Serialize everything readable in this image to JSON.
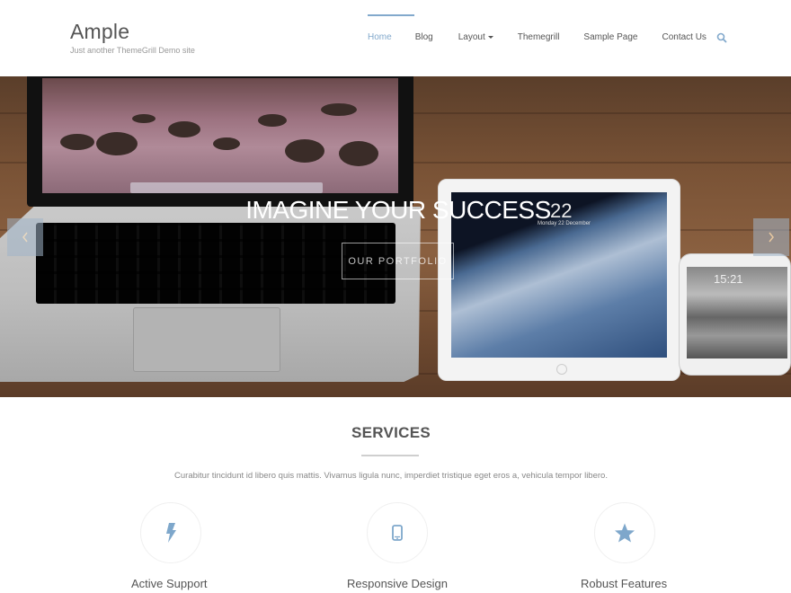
{
  "header": {
    "site_title": "Ample",
    "tagline": "Just another ThemeGrill Demo site",
    "nav": [
      {
        "label": "Home",
        "active": true
      },
      {
        "label": "Blog",
        "active": false
      },
      {
        "label": "Layout",
        "active": false,
        "has_dropdown": true
      },
      {
        "label": "Themegrill",
        "active": false
      },
      {
        "label": "Sample Page",
        "active": false
      },
      {
        "label": "Contact Us",
        "active": false
      }
    ],
    "search_icon": "search-icon",
    "accent_color": "#82a9cc"
  },
  "slider": {
    "caption": "IMAGINE YOUR SUCCESS",
    "button_label": "OUR PORTFOLIO",
    "prev_icon": "chevron-left-icon",
    "next_icon": "chevron-right-icon",
    "ipad_time": "22",
    "ipad_date": "Monday 22 December",
    "iphone_time": "15:21"
  },
  "services": {
    "title": "SERVICES",
    "description": "Curabitur tincidunt id libero quis mattis. Vivamus ligula nunc, imperdiet tristique eget eros a, vehicula tempor libero.",
    "items": [
      {
        "title": "Active Support",
        "icon": "bolt-icon"
      },
      {
        "title": "Responsive Design",
        "icon": "mobile-icon"
      },
      {
        "title": "Robust Features",
        "icon": "star-icon"
      }
    ],
    "icon_color": "#7ea7cb"
  }
}
